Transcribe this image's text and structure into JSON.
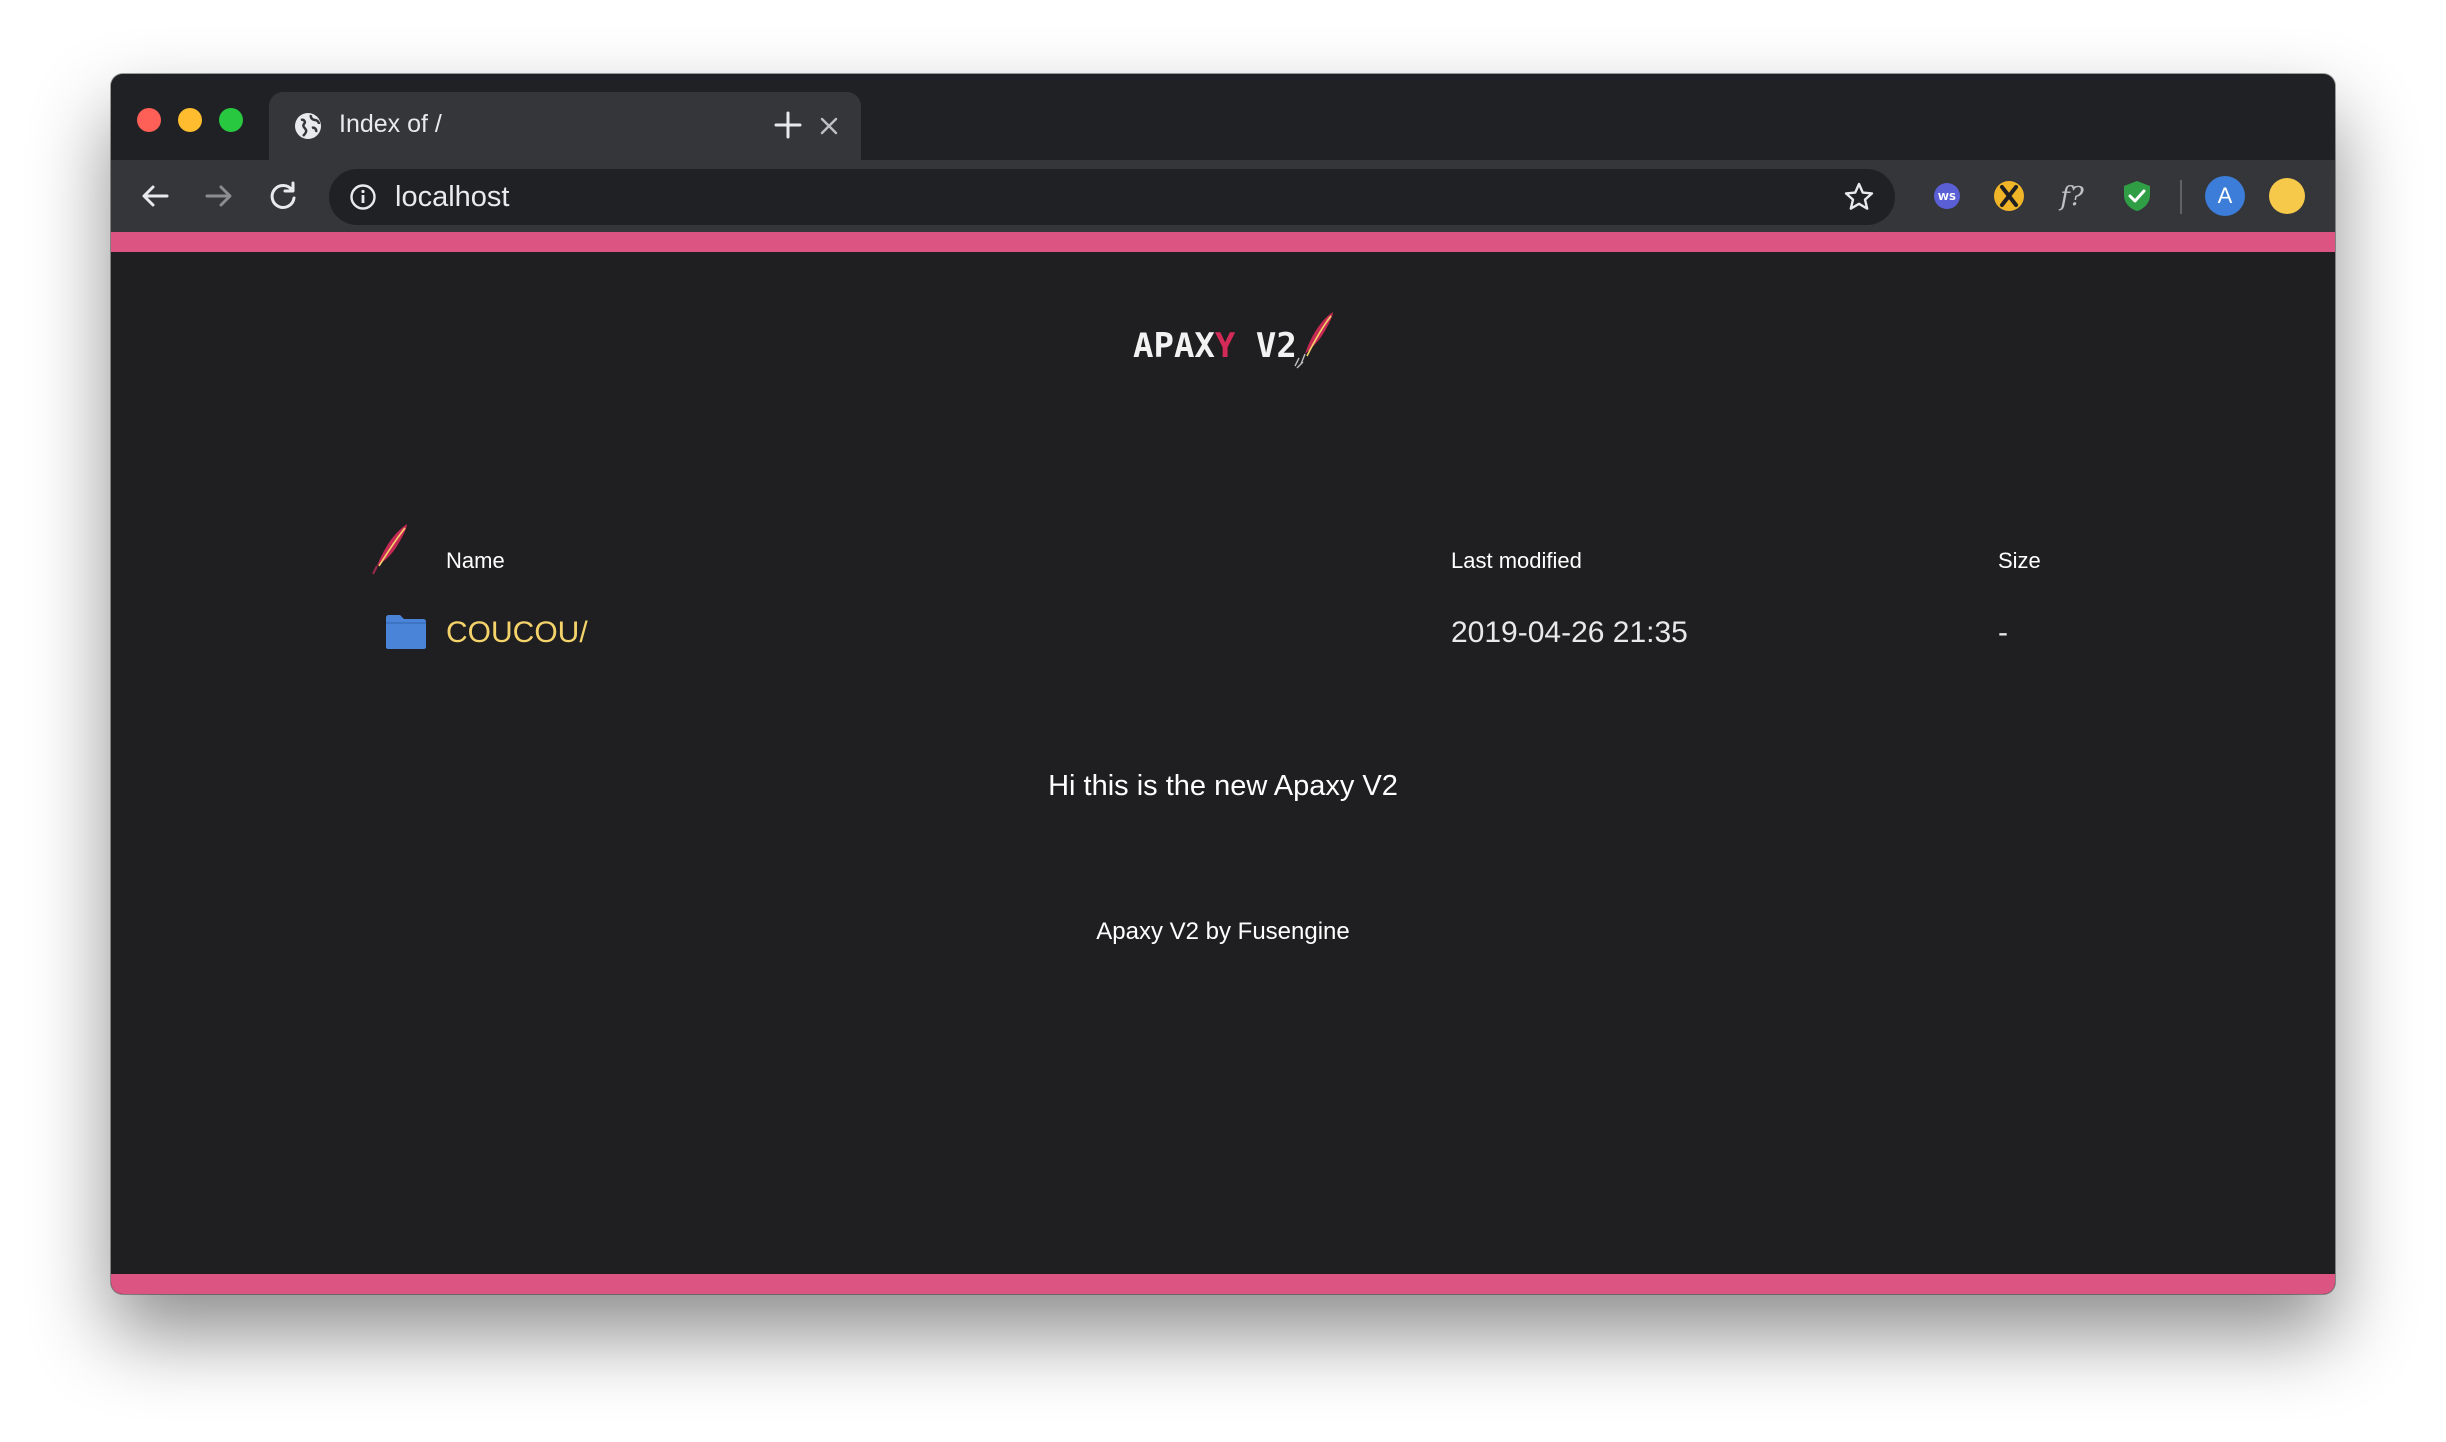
{
  "browser": {
    "tab_title": "Index of /",
    "url": "localhost",
    "avatar_letter": "A",
    "accent_color": "#dc5481",
    "extensions": [
      "ws-icon",
      "x-icon",
      "f-question-icon",
      "shield-check-icon",
      "update-icon"
    ]
  },
  "page": {
    "logo": {
      "part1": "APAX",
      "part2": "Y",
      "part3": " V2"
    },
    "columns": {
      "name": "Name",
      "last_modified": "Last modified",
      "size": "Size"
    },
    "entries": [
      {
        "name": "COUCOU/",
        "last_modified": "2019-04-26 21:35",
        "size": "-",
        "icon": "folder-icon"
      }
    ],
    "readme": "Hi this is the new Apaxy V2",
    "footer": "Apaxy V2 by Fusengine",
    "colors": {
      "background": "#1f1f21",
      "link": "#f5d36b",
      "accent": "#dc5481",
      "feather": "#c62a54"
    }
  }
}
